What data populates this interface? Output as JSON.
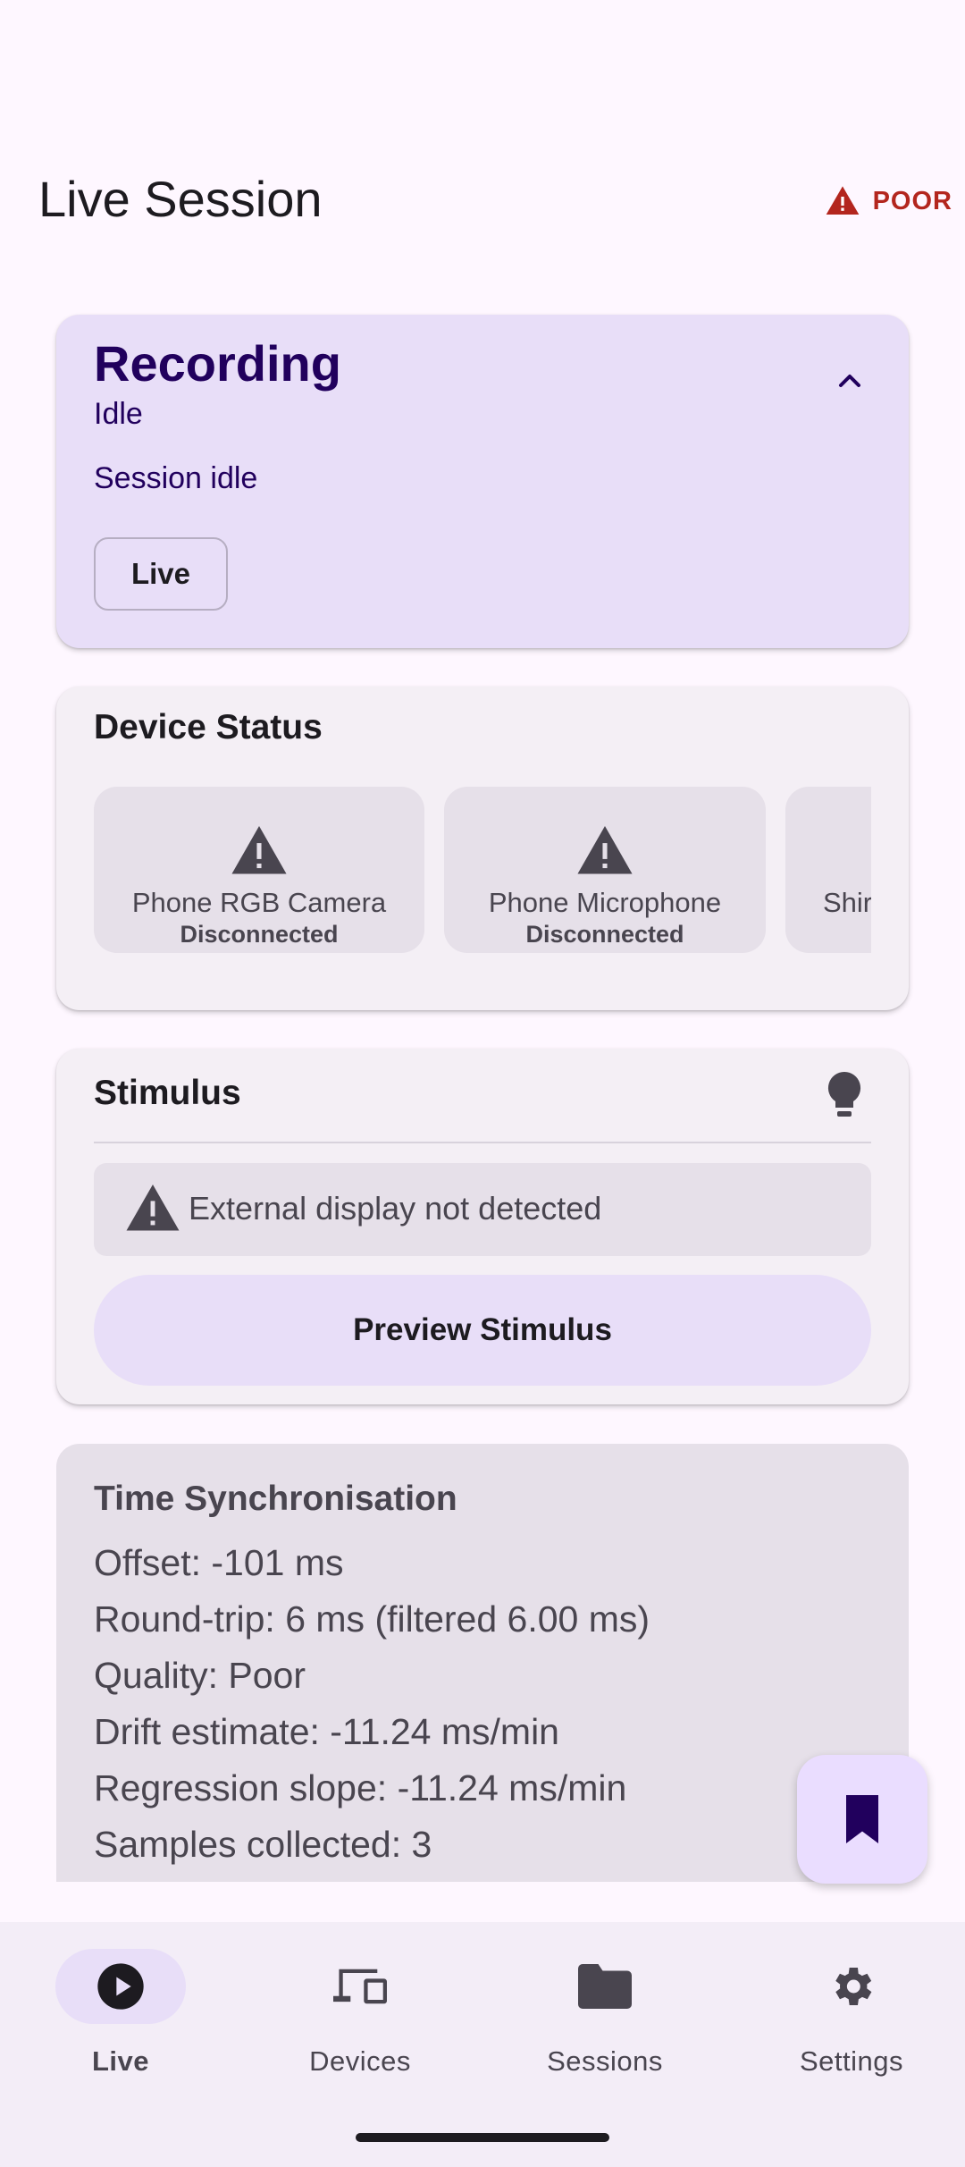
{
  "header": {
    "title": "Live Session",
    "quality_label": "POOR",
    "quality_color": "#B3261E"
  },
  "recording": {
    "title": "Recording",
    "state": "Idle",
    "message": "Session idle",
    "mode_button": "Live",
    "collapse_icon": "chevron-up-icon"
  },
  "devices": {
    "title": "Device Status",
    "items": [
      {
        "name": "Phone RGB Camera",
        "status": "Disconnected",
        "icon": "warning-icon"
      },
      {
        "name": "Phone Microphone",
        "status": "Disconnected",
        "icon": "warning-icon"
      },
      {
        "name": "Shir",
        "status": "",
        "icon": "warning-icon"
      }
    ]
  },
  "stimulus": {
    "title": "Stimulus",
    "icon": "lightbulb-icon",
    "warning": "External display not detected",
    "preview_button": "Preview Stimulus"
  },
  "time_sync": {
    "title": "Time Synchronisation",
    "offset": "Offset: -101 ms",
    "round_trip": "Round-trip: 6 ms (filtered 6.00 ms)",
    "quality": "Quality: Poor",
    "drift": "Drift estimate: -11.24 ms/min",
    "slope": "Regression slope: -11.24 ms/min",
    "samples": "Samples collected: 3"
  },
  "fab": {
    "icon": "bookmark-icon"
  },
  "nav": {
    "items": [
      {
        "label": "Live",
        "icon": "play-circle-icon",
        "active": true
      },
      {
        "label": "Devices",
        "icon": "devices-icon",
        "active": false
      },
      {
        "label": "Sessions",
        "icon": "folder-icon",
        "active": false
      },
      {
        "label": "Settings",
        "icon": "gear-icon",
        "active": false
      }
    ]
  },
  "colors": {
    "background": "#FEF7FF",
    "primary_container": "#E8DEF8",
    "surface_variant": "#E6E0E9",
    "on_primary_container": "#21005D",
    "error": "#B3261E"
  }
}
